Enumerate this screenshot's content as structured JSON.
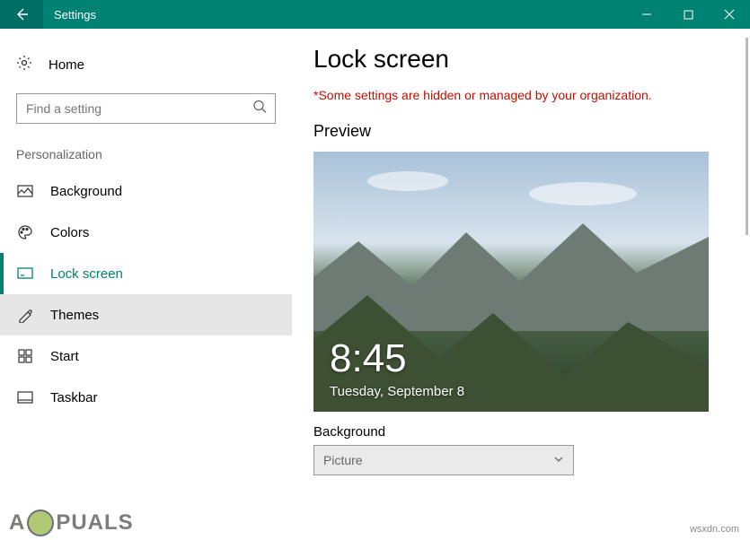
{
  "titlebar": {
    "title": "Settings"
  },
  "sidebar": {
    "home": "Home",
    "search_placeholder": "Find a setting",
    "group": "Personalization",
    "items": [
      {
        "label": "Background"
      },
      {
        "label": "Colors"
      },
      {
        "label": "Lock screen"
      },
      {
        "label": "Themes"
      },
      {
        "label": "Start"
      },
      {
        "label": "Taskbar"
      }
    ]
  },
  "main": {
    "heading": "Lock screen",
    "warning": "*Some settings are hidden or managed by your organization.",
    "preview_label": "Preview",
    "preview_time": "8:45",
    "preview_date": "Tuesday, September 8",
    "background_label": "Background",
    "background_value": "Picture"
  },
  "watermark": {
    "text_before": "A",
    "text_after": "PUALS"
  },
  "credit": "wsxdn.com"
}
